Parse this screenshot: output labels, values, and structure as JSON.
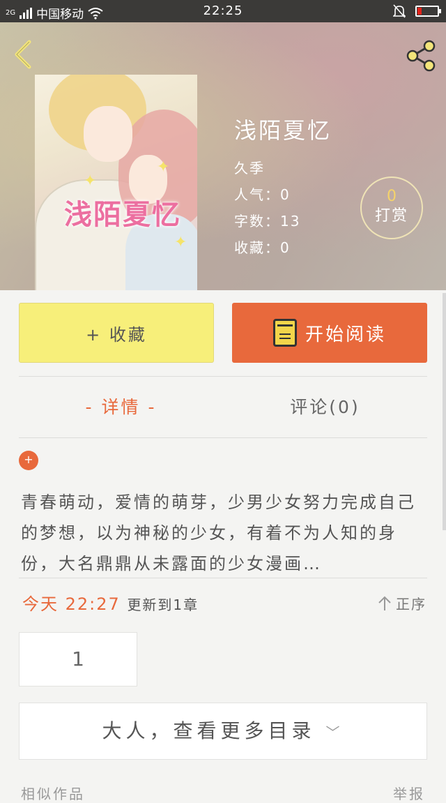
{
  "status_bar": {
    "signal": "2G",
    "carrier": "中国移动",
    "time": "22:25"
  },
  "book": {
    "title": "浅陌夏忆",
    "cover_title": "浅陌夏忆",
    "author": "久季",
    "popularity": "人气：0",
    "word_count": "字数：13",
    "favorites": "收藏：0"
  },
  "tip": {
    "count": "0",
    "label": "打赏"
  },
  "actions": {
    "favorite_label": "+ 收藏",
    "read_label": "开始阅读"
  },
  "tabs": {
    "detail": "- 详情 -",
    "comments": "评论(0)"
  },
  "expand_label": "+",
  "description": "青春萌动，爱情的萌芽，少男少女努力完成自己的梦想，以为神秘的少女，有着不为人知的身份，大名鼎鼎从未露面的少女漫画…",
  "update": {
    "time": "今天 22:27",
    "text": "更新到1章",
    "order_label": "正序"
  },
  "chapters": [
    "1"
  ],
  "more_label": "大人，查看更多目录",
  "footer": {
    "left": "相似作品",
    "right": "举报"
  },
  "colors": {
    "accent": "#e8693c",
    "favorite_bg": "#f7ef7a",
    "tip_number": "#f5d36a"
  }
}
